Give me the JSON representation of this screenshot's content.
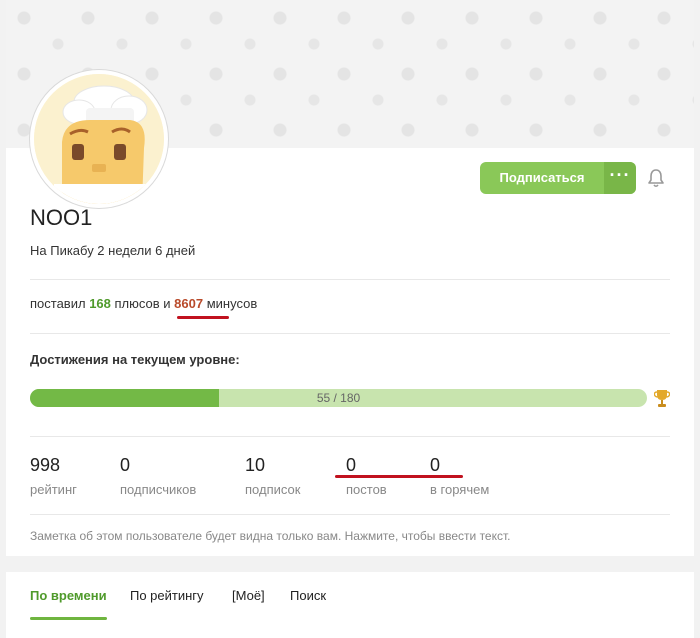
{
  "profile": {
    "username": "NOO1",
    "since": "На Пикабу 2 недели 6 дней",
    "subscribe_label": "Подписаться",
    "more_label": "···"
  },
  "votes": {
    "prefix": "поставил",
    "plus": "168",
    "mid": "плюсов и",
    "minus": "8607",
    "suffix": "минусов"
  },
  "achievements": {
    "title": "Достижения на текущем уровне:",
    "progress_text": "55 / 180",
    "progress_fraction": 0.306
  },
  "stats": [
    {
      "value": "998",
      "label": "рейтинг"
    },
    {
      "value": "0",
      "label": "подписчиков"
    },
    {
      "value": "10",
      "label": "подписок"
    },
    {
      "value": "0",
      "label": "постов"
    },
    {
      "value": "0",
      "label": "в горячем"
    }
  ],
  "note": "Заметка об этом пользователе будет видна только вам. Нажмите, чтобы ввести текст.",
  "tabs": [
    {
      "label": "По времени",
      "active": true
    },
    {
      "label": "По рейтингу",
      "active": false
    },
    {
      "label": "[Моё]",
      "active": false
    },
    {
      "label": "Поиск",
      "active": false
    }
  ],
  "colors": {
    "accent": "#8ac858",
    "plus": "#4f9a2b",
    "minus": "#b94a2a",
    "annotation": "#c1121f"
  },
  "icons": [
    "chef-avatar",
    "bell-icon",
    "trophy-icon"
  ]
}
